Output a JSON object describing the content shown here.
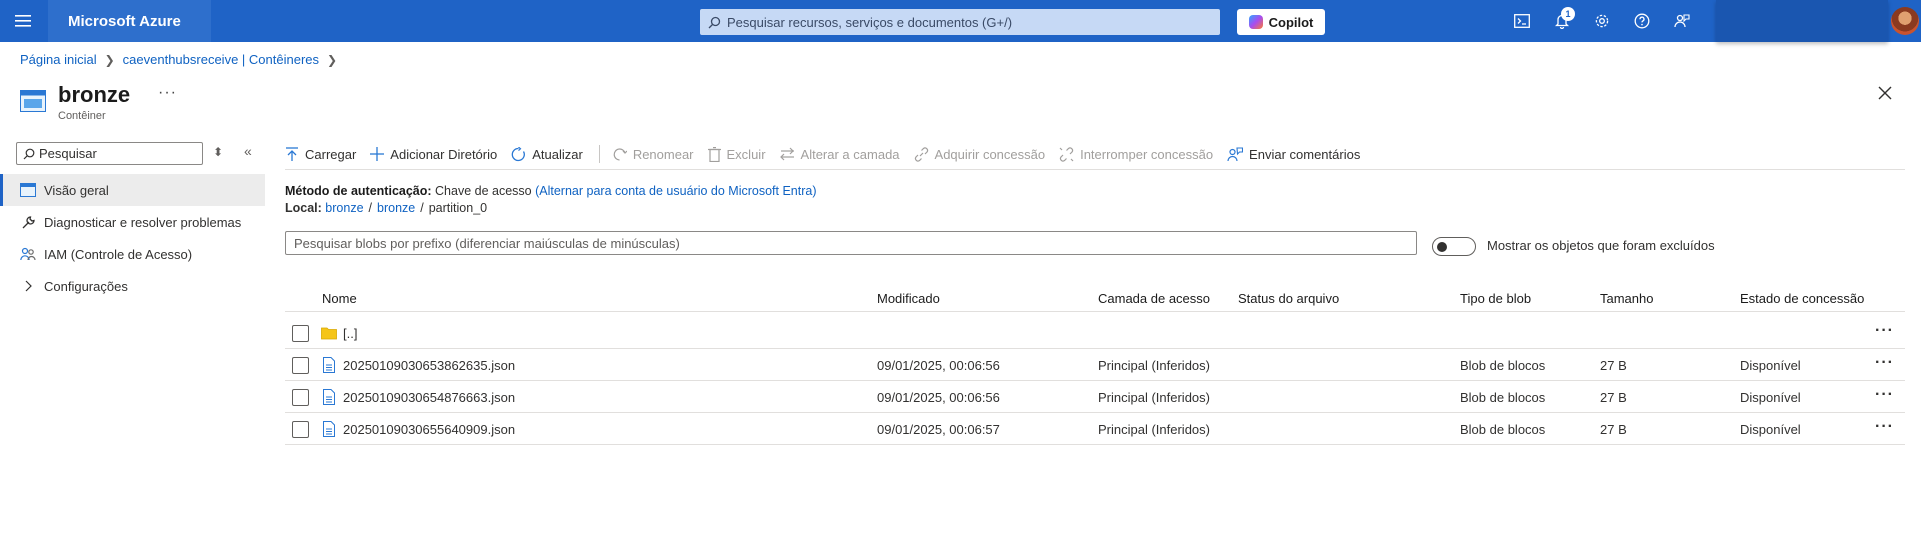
{
  "topbar": {
    "brand": "Microsoft Azure",
    "search_placeholder": "Pesquisar recursos, serviços e documentos (G+/)",
    "copilot_label": "Copilot",
    "notification_count": "1"
  },
  "breadcrumb": {
    "home": "Página inicial",
    "parent": "caeventhubsreceive | Contêineres"
  },
  "page": {
    "title": "bronze",
    "subtitle": "Contêiner",
    "more": "···"
  },
  "sidebar": {
    "search_label": "Pesquisar",
    "items": [
      {
        "label": "Visão geral",
        "icon": "overview-icon"
      },
      {
        "label": "Diagnosticar e resolver problemas",
        "icon": "wrench-icon"
      },
      {
        "label": "IAM (Controle de Acesso)",
        "icon": "people-icon"
      },
      {
        "label": "Configurações",
        "icon": "chevron-right-icon"
      }
    ]
  },
  "toolbar": {
    "upload": "Carregar",
    "add_dir": "Adicionar Diretório",
    "refresh": "Atualizar",
    "rename": "Renomear",
    "delete": "Excluir",
    "change_tier": "Alterar a camada",
    "acquire_lease": "Adquirir concessão",
    "break_lease": "Interromper concessão",
    "feedback": "Enviar comentários"
  },
  "auth": {
    "label": "Método de autenticação:",
    "value": "Chave de acesso",
    "switch_link": "(Alternar para conta de usuário do Microsoft Entra)"
  },
  "location": {
    "label": "Local:",
    "path": [
      "bronze",
      "bronze",
      "partition_0"
    ]
  },
  "blob_search": {
    "placeholder": "Pesquisar blobs por prefixo (diferenciar maiúsculas de minúsculas)"
  },
  "show_deleted": {
    "label": "Mostrar os objetos que foram excluídos",
    "on": false
  },
  "table": {
    "headers": {
      "name": "Nome",
      "modified": "Modificado",
      "tier": "Camada de acesso",
      "archive_status": "Status do arquivo",
      "blob_type": "Tipo de blob",
      "size": "Tamanho",
      "lease": "Estado de concessão"
    },
    "parent_row": {
      "name": "[..]"
    },
    "rows": [
      {
        "name": "20250109030653862635.json",
        "modified": "09/01/2025, 00:06:56",
        "tier": "Principal (Inferidos)",
        "archive_status": "",
        "blob_type": "Blob de blocos",
        "size": "27 B",
        "lease": "Disponível"
      },
      {
        "name": "20250109030654876663.json",
        "modified": "09/01/2025, 00:06:56",
        "tier": "Principal (Inferidos)",
        "archive_status": "",
        "blob_type": "Blob de blocos",
        "size": "27 B",
        "lease": "Disponível"
      },
      {
        "name": "20250109030655640909.json",
        "modified": "09/01/2025, 00:06:57",
        "tier": "Principal (Inferidos)",
        "archive_status": "",
        "blob_type": "Blob de blocos",
        "size": "27 B",
        "lease": "Disponível"
      }
    ],
    "row_more": "···"
  },
  "colors": {
    "topbar": "#1f63c6",
    "link": "#0f62c2",
    "disabled": "#a19f9d"
  }
}
